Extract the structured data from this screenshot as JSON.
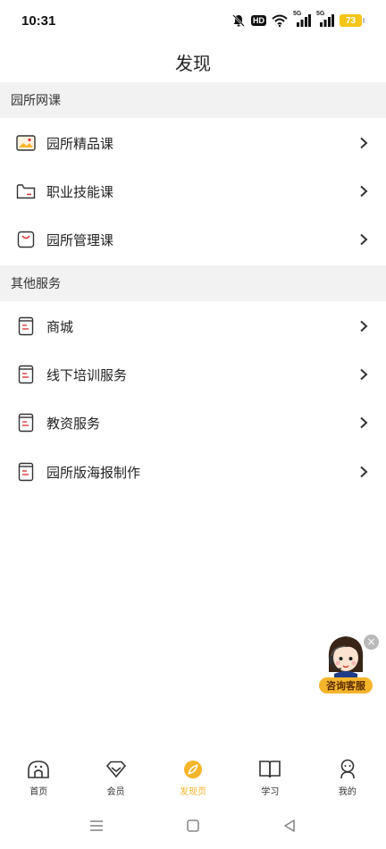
{
  "status_bar": {
    "time": "10:31",
    "hd": "HD",
    "network1": "5G",
    "network2": "5G",
    "battery": "73"
  },
  "header": {
    "title": "发现"
  },
  "sections": [
    {
      "title": "园所网课",
      "items": [
        {
          "label": "园所精品课",
          "icon": "image-frame-icon"
        },
        {
          "label": "职业技能课",
          "icon": "folder-icon"
        },
        {
          "label": "园所管理课",
          "icon": "shopping-bag-icon"
        }
      ]
    },
    {
      "title": "其他服务",
      "items": [
        {
          "label": "商城",
          "icon": "document-icon"
        },
        {
          "label": "线下培训服务",
          "icon": "document-icon"
        },
        {
          "label": "教资服务",
          "icon": "document-icon"
        },
        {
          "label": "园所版海报制作",
          "icon": "document-icon"
        }
      ]
    }
  ],
  "floating_service": {
    "label": "咨询客服",
    "close": "×"
  },
  "bottom_nav": [
    {
      "label": "首页",
      "icon": "home-icon",
      "active": false
    },
    {
      "label": "会员",
      "icon": "diamond-icon",
      "active": false
    },
    {
      "label": "发现页",
      "icon": "compass-icon",
      "active": true
    },
    {
      "label": "学习",
      "icon": "book-icon",
      "active": false
    },
    {
      "label": "我的",
      "icon": "profile-icon",
      "active": false
    }
  ],
  "colors": {
    "accent": "#f5b52a",
    "section_bg": "#f2f2f2",
    "icon_red": "#e0393e"
  }
}
